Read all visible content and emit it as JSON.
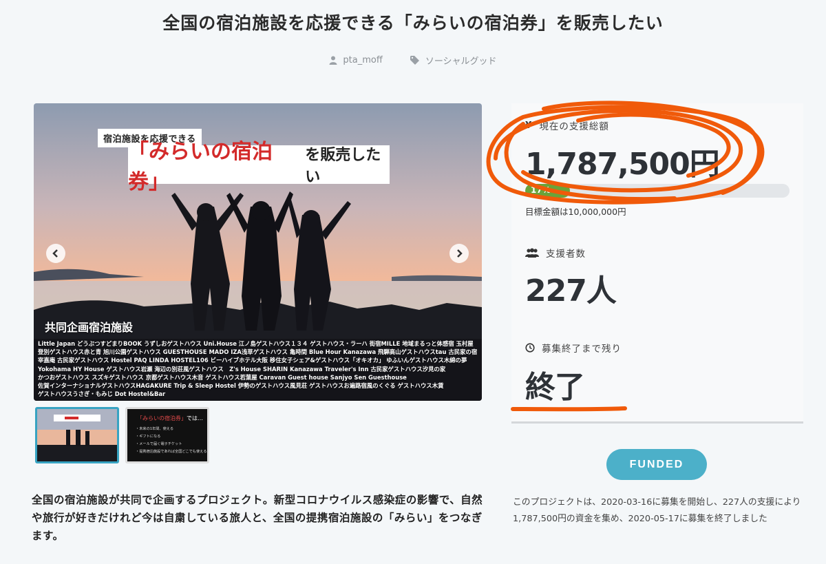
{
  "page": {
    "title": "全国の宿泊施設を応援できる「みらいの宿泊券」を販売したい",
    "author": "pta_moff",
    "category": "ソーシャルグッド"
  },
  "hero": {
    "tag_small": "宿泊施設を応援できる",
    "tag_big_red": "「みらいの宿泊券」",
    "tag_big_rest": "を販売したい",
    "partners_heading": "共同企画宿泊施設",
    "partner_lines": [
      "Little Japan どうぶつすどまりBOOK うずしおゲストハウス Uni.House 江ノ島ゲストハウス１３４ ゲストハウス・ラーハ 街宿MILLE 地域まるっと体感宿 玉村屋",
      "登別ゲストハウス赤と青 旭川公園ゲストハウス GUESTHOUSE MADO IZA浅草ゲストハウス 亀時間 Blue Hour Kanazawa 飛騨高山ゲストハウスtau 古民家の宿",
      "宰嘉庵 古民家ゲストハウス Hostel PAQ LINDA HOSTEL106 ビーハイブホテル大阪 移住女子シェア&ゲストハウス「オキオカ」 ゆふいんゲストハウス木綿の夢",
      "Yokohama HY House ゲストハウス岩瀬 海辺の別荘風ゲストハウス　Z's House SHARIN Kanazawa Traveler's Inn 古民家ゲストハウス汐見の家",
      "かつおゲストハウス スズキゲストハウス 京都ゲストハウス木音 ゲストハウス若葉屋 Caravan Guest house Sanjyo Sen Guesthouse",
      "佐賀インターナショナルゲストハウスHAGAKURE Trip & Sleep Hostel 伊勢のゲストハウス風見荘 ゲストハウスお遍路宿風のくぐる ゲストハウス木賃",
      "ゲストハウスうさぎ・もみじ Dot Hostel&Bar"
    ]
  },
  "thumb2": {
    "title_red": "「みらいの宿泊券」",
    "title_rest": "では…",
    "items": [
      "・未来の1年間、使える",
      "・ギフトになる",
      "・メールで届く電子チケット",
      "・提携宿泊施設であれば全国どこでも使える"
    ]
  },
  "description": "全国の宿泊施設が共同で企画するプロジェクト。新型コロナウイルス感染症の影響で、自然や旅行が好きだけれど今は自粛している旅人と、全国の提携宿泊施設の「みらい」をつなぎます。",
  "stats": {
    "total_label": "現在の支援総額",
    "total_value": "1,787,500円",
    "progress_label": "17%",
    "progress": 0.17,
    "goal_text": "目標金額は10,000,000円",
    "backers_label": "支援者数",
    "backers_value": "227人",
    "remaining_label": "募集終了まで残り",
    "remaining_value": "終了"
  },
  "funded_button": "FUNDED",
  "summary": "このプロジェクトは、2020-03-16に募集を開始し、227人の支援により1,787,500円の資金を集め、2020-05-17に募集を終了しました",
  "colors": {
    "accent": "#4cb0c9",
    "progress": "#6aa33a",
    "annotation": "#f05a0a"
  }
}
